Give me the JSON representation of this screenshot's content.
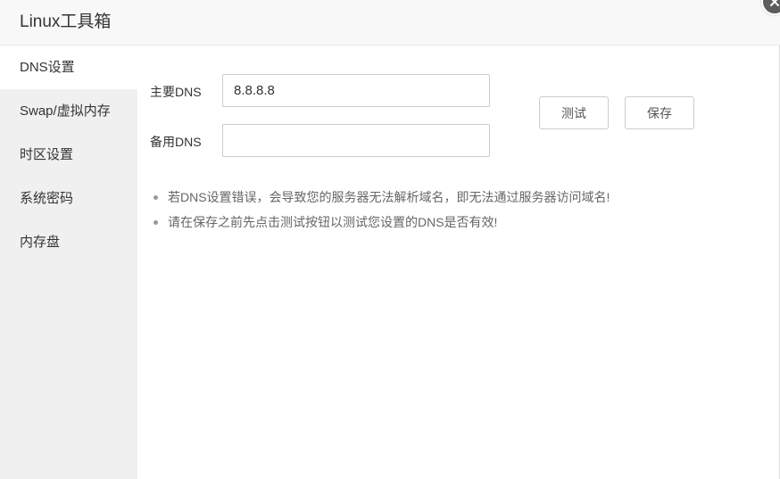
{
  "window": {
    "title": "Linux工具箱"
  },
  "sidebar": {
    "items": [
      {
        "label": "DNS设置",
        "active": true
      },
      {
        "label": "Swap/虚拟内存"
      },
      {
        "label": "时区设置"
      },
      {
        "label": "系统密码"
      },
      {
        "label": "内存盘"
      }
    ]
  },
  "dns": {
    "primary_label": "主要DNS",
    "primary_value": "8.8.8.8",
    "secondary_label": "备用DNS",
    "secondary_value": "",
    "test_button": "测试",
    "save_button": "保存"
  },
  "tips": [
    "若DNS设置错误，会导致您的服务器无法解析域名，即无法通过服务器访问域名!",
    "请在保存之前先点击测试按钮以测试您设置的DNS是否有效!"
  ],
  "icons": {
    "close": "close-icon",
    "bullet": "bullet-dot"
  },
  "colors": {
    "titlebar_bg": "#f8f8f8",
    "sidebar_bg": "#f0f0f0",
    "active_item_bg": "#ffffff",
    "close_button_bg": "#5c5c5c"
  }
}
